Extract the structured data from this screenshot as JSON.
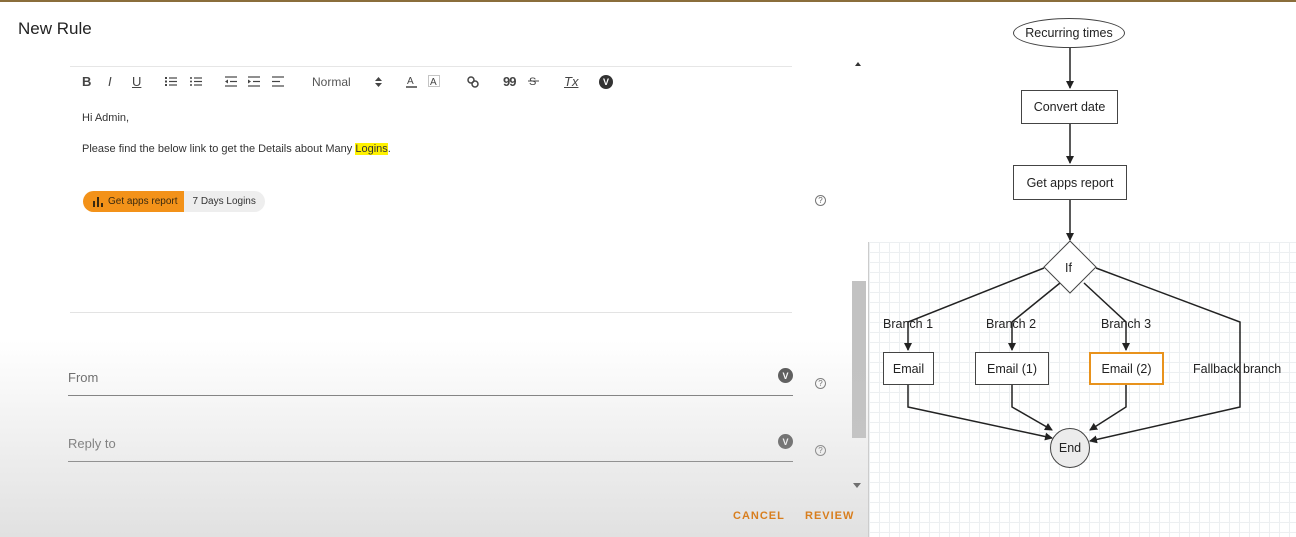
{
  "panel": {
    "title": "New Rule"
  },
  "toolbar": {
    "bold": "B",
    "italic": "I",
    "underline": "U",
    "format_select": "Normal",
    "quote": "99",
    "clear_format": "Tx",
    "variable": "V"
  },
  "editor": {
    "line1": "Hi Admin,",
    "line2_before": "Please find the below link to get the Details about Many ",
    "line2_highlight": "Logins",
    "line2_after": ".",
    "chip_action": "Get apps report",
    "chip_value": "7 Days Logins"
  },
  "fields": {
    "from_label": "From",
    "reply_to_label": "Reply to",
    "variable_icon": "V"
  },
  "help_icon": "?",
  "actions": {
    "cancel": "CANCEL",
    "review": "REVIEW"
  },
  "flow": {
    "start": "Recurring times",
    "step1": "Convert date",
    "step2": "Get apps report",
    "decision": "If",
    "branch1": "Branch 1",
    "branch2": "Branch 2",
    "branch3": "Branch 3",
    "fallback": "Fallback branch",
    "email": "Email",
    "email1": "Email (1)",
    "email2": "Email (2)",
    "end": "End",
    "highlight_color": "#e8921c"
  }
}
